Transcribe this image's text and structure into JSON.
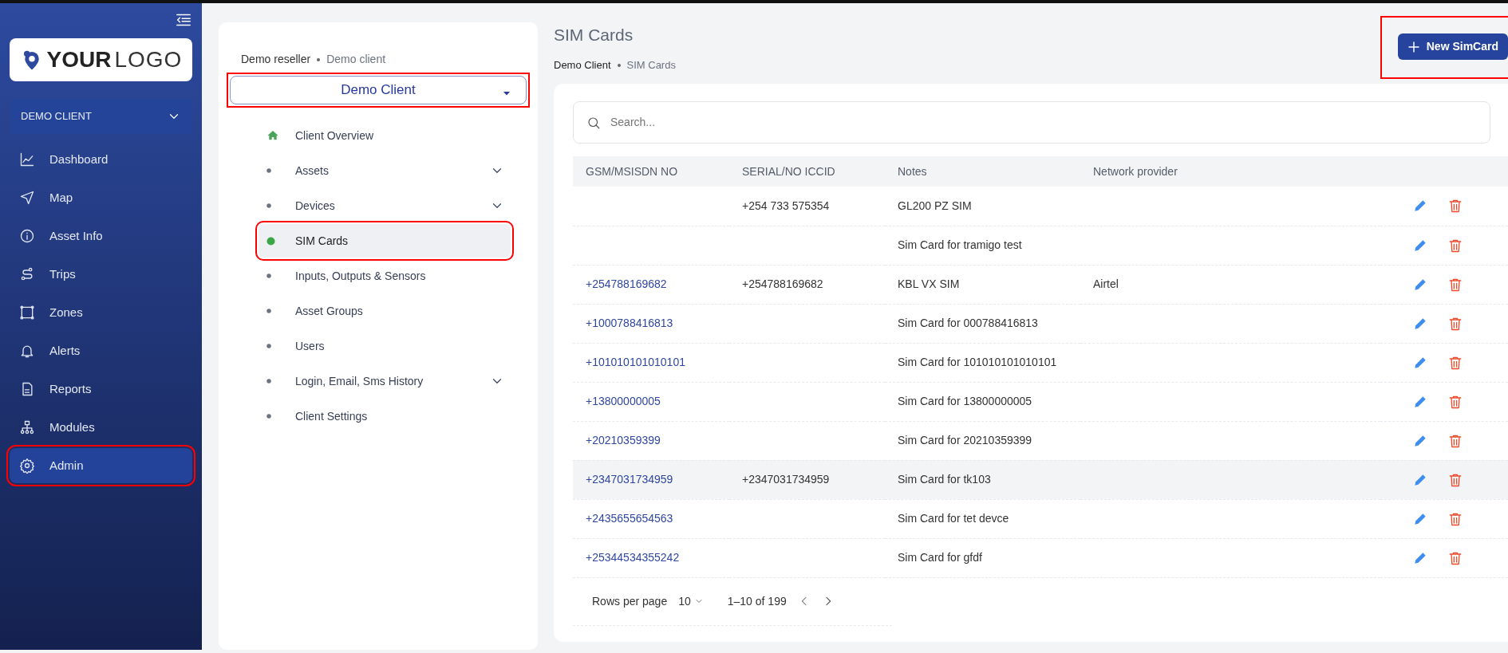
{
  "sidebar": {
    "logo": {
      "bold": "YOUR",
      "light": "LOGO"
    },
    "client_dropdown": "DEMO CLIENT",
    "items": [
      {
        "label": "Dashboard",
        "selected": false,
        "highlighted": false
      },
      {
        "label": "Map",
        "selected": false,
        "highlighted": false
      },
      {
        "label": "Asset Info",
        "selected": false,
        "highlighted": false
      },
      {
        "label": "Trips",
        "selected": false,
        "highlighted": false
      },
      {
        "label": "Zones",
        "selected": false,
        "highlighted": false
      },
      {
        "label": "Alerts",
        "selected": false,
        "highlighted": false
      },
      {
        "label": "Reports",
        "selected": false,
        "highlighted": false
      },
      {
        "label": "Modules",
        "selected": false,
        "highlighted": false
      },
      {
        "label": "Admin",
        "selected": true,
        "highlighted": true
      }
    ]
  },
  "client_panel": {
    "breadcrumb": [
      "Demo reseller",
      "Demo client"
    ],
    "client_select": {
      "value": "Demo Client",
      "highlighted": true
    },
    "items": [
      {
        "kind": "home",
        "label": "Client Overview",
        "selected": false,
        "expandable": false,
        "highlighted": false
      },
      {
        "kind": "bullet",
        "label": "Assets",
        "selected": false,
        "expandable": true,
        "highlighted": false
      },
      {
        "kind": "bullet",
        "label": "Devices",
        "selected": false,
        "expandable": true,
        "highlighted": false
      },
      {
        "kind": "bullet",
        "label": "SIM Cards",
        "selected": true,
        "expandable": false,
        "highlighted": true
      },
      {
        "kind": "bullet",
        "label": "Inputs, Outputs & Sensors",
        "selected": false,
        "expandable": false,
        "highlighted": false
      },
      {
        "kind": "bullet",
        "label": "Asset Groups",
        "selected": false,
        "expandable": false,
        "highlighted": false
      },
      {
        "kind": "bullet",
        "label": "Users",
        "selected": false,
        "expandable": false,
        "highlighted": false
      },
      {
        "kind": "bullet",
        "label": "Login, Email, Sms History",
        "selected": false,
        "expandable": true,
        "highlighted": false
      },
      {
        "kind": "bullet",
        "label": "Client Settings",
        "selected": false,
        "expandable": false,
        "highlighted": false
      }
    ]
  },
  "page": {
    "title": "SIM Cards",
    "breadcrumb": [
      "Demo Client",
      "SIM Cards"
    ],
    "new_button": {
      "label": "New SimCard",
      "highlighted": true
    }
  },
  "search": {
    "placeholder": "Search..."
  },
  "table": {
    "columns": [
      "GSM/MSISDN NO",
      "SERIAL/NO ICCID",
      "Notes",
      "Network provider"
    ],
    "rows": [
      {
        "gsm": "",
        "serial": "+254 733 575354",
        "notes": "GL200 PZ SIM",
        "provider": "",
        "hovered": false
      },
      {
        "gsm": "",
        "serial": "",
        "notes": "Sim Card for tramigo test",
        "provider": "",
        "hovered": false
      },
      {
        "gsm": "+254788169682",
        "serial": "+254788169682",
        "notes": "KBL VX SIM",
        "provider": "Airtel",
        "hovered": false
      },
      {
        "gsm": "+1000788416813",
        "serial": "",
        "notes": "Sim Card for 000788416813",
        "provider": "",
        "hovered": false
      },
      {
        "gsm": "+101010101010101",
        "serial": "",
        "notes": "Sim Card for 101010101010101",
        "provider": "",
        "hovered": false
      },
      {
        "gsm": "+13800000005",
        "serial": "",
        "notes": "Sim Card for 13800000005",
        "provider": "",
        "hovered": false
      },
      {
        "gsm": "+20210359399",
        "serial": "",
        "notes": "Sim Card for 20210359399",
        "provider": "",
        "hovered": false
      },
      {
        "gsm": "+2347031734959",
        "serial": "+2347031734959",
        "notes": "Sim Card for tk103",
        "provider": "",
        "hovered": true
      },
      {
        "gsm": "+2435655654563",
        "serial": "",
        "notes": "Sim Card for tet devce",
        "provider": "",
        "hovered": false
      },
      {
        "gsm": "+25344534355242",
        "serial": "",
        "notes": "Sim Card for gfdf",
        "provider": "",
        "hovered": false
      }
    ]
  },
  "pagination": {
    "rows_label": "Rows per page",
    "rows_value": "10",
    "range": "1–10 of 199"
  }
}
